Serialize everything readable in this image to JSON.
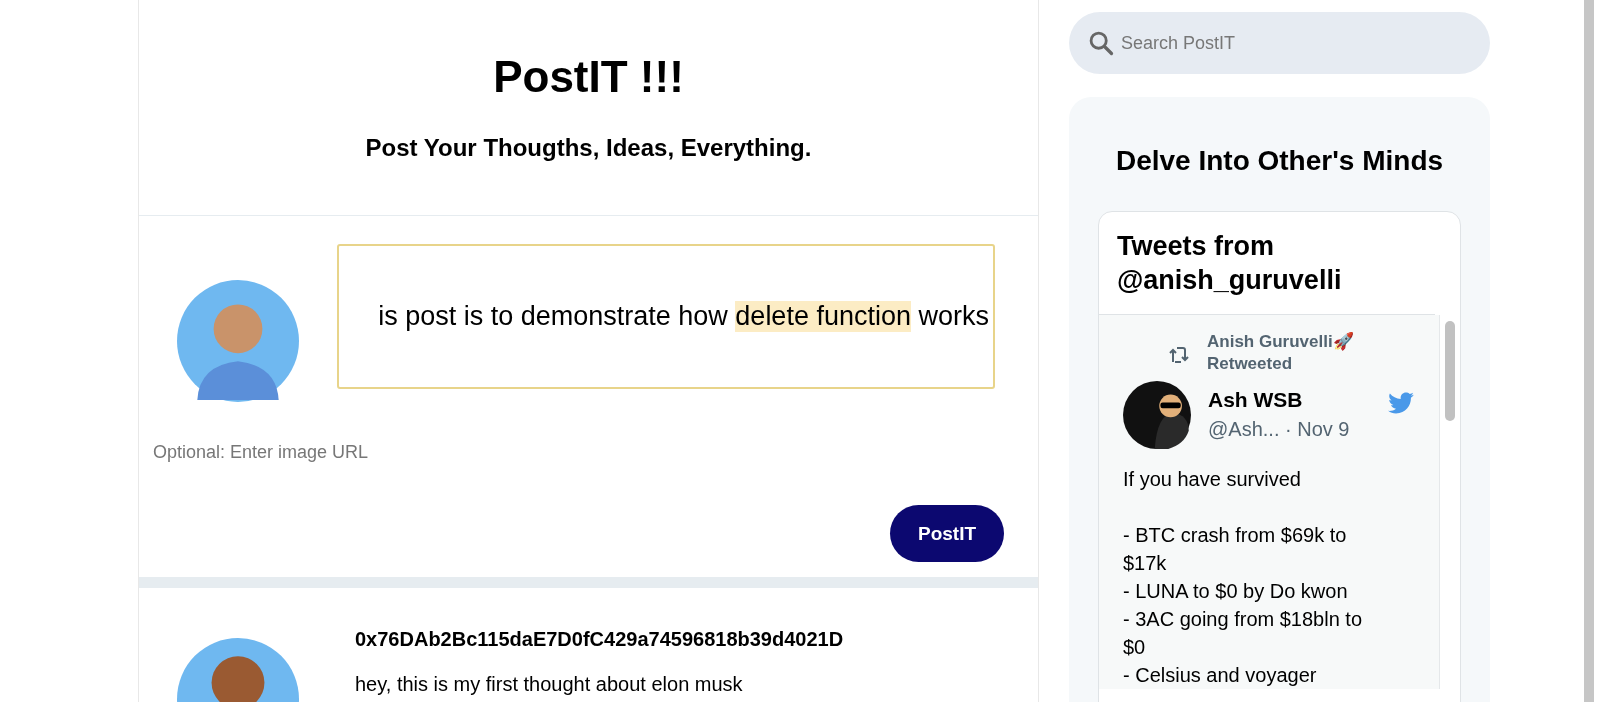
{
  "header": {
    "title": "PostIT !!!",
    "subtitle": "Post Your Thougths, Ideas, Everything."
  },
  "composer": {
    "text": {
      "before": "is post is to demonstrate how ",
      "selected": "delete function",
      "after": " works"
    },
    "image_url": {
      "placeholder": "Optional: Enter image URL"
    },
    "submit": "PostIT"
  },
  "posts": [
    {
      "author": "0x76DAb2Bc115daE7D0fC429a74596818b39d4021D",
      "text": "hey, this is my first thought about elon musk"
    }
  ],
  "search": {
    "placeholder": "Search PostIT"
  },
  "widget": {
    "title": "Delve Into Other's Minds",
    "embed_title": "Tweets from @anish_guruvelli",
    "tweets": [
      {
        "retweeted_by": "Anish Guruvelli🚀",
        "retweet_label": "Retweeted",
        "name": "Ash WSB",
        "handle": "@Ash...",
        "date": "· Nov 9",
        "text": "If you have survived\n\n- BTC crash from $69k to $17k\n- LUNA to $0 by Do kwon\n- 3AC going from $18bln to $0\n- Celsius and voyager"
      }
    ]
  }
}
